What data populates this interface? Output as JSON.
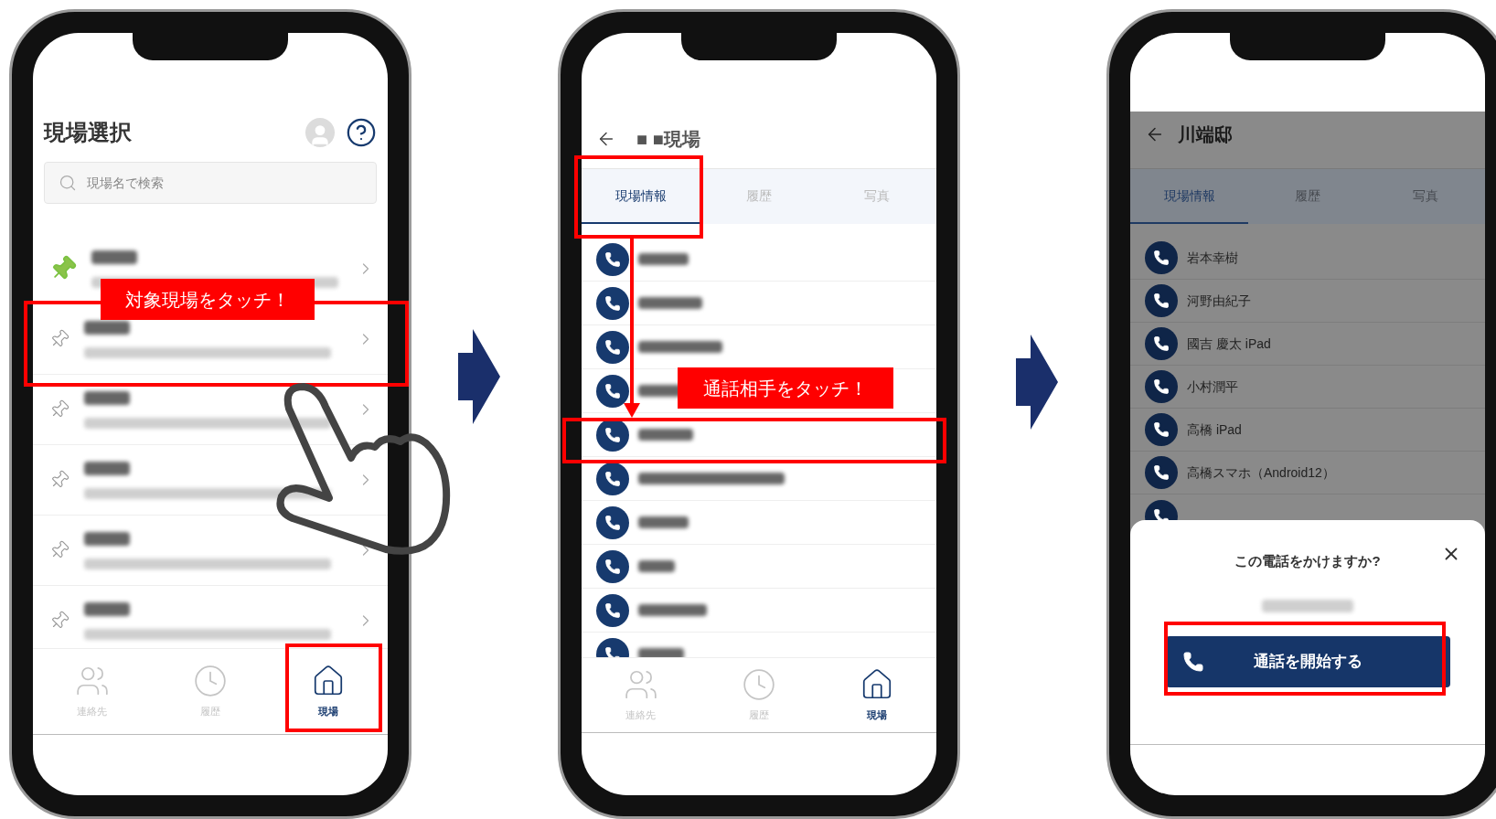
{
  "phones": [
    {
      "kind": "site_list",
      "title": "現場選択",
      "search": {
        "placeholder": "現場名で検索"
      },
      "sites": [
        {
          "pinned": true,
          "highlighted": false
        },
        {
          "pinned": false,
          "highlighted": true
        },
        {
          "pinned": false,
          "highlighted": false
        },
        {
          "pinned": false,
          "highlighted": false
        },
        {
          "pinned": false,
          "highlighted": false
        },
        {
          "pinned": false,
          "highlighted": false
        }
      ],
      "callout": "対象現場をタッチ！",
      "nav": [
        {
          "label": "連絡先",
          "selected": false,
          "highlighted": false
        },
        {
          "label": "履歴",
          "selected": false,
          "highlighted": false
        },
        {
          "label": "現場",
          "selected": true,
          "highlighted": true
        }
      ]
    },
    {
      "kind": "site_detail",
      "title": "■ ■現場",
      "tabs": [
        {
          "label": "現場情報",
          "selected": true,
          "highlighted": true
        },
        {
          "label": "履歴",
          "selected": false,
          "highlighted": false
        },
        {
          "label": "写真",
          "selected": false,
          "highlighted": false
        }
      ],
      "contacts": [
        {
          "highlighted": false
        },
        {
          "highlighted": false
        },
        {
          "highlighted": false
        },
        {
          "highlighted": false
        },
        {
          "highlighted": true
        },
        {
          "highlighted": false
        },
        {
          "highlighted": false
        },
        {
          "highlighted": false
        },
        {
          "highlighted": false
        },
        {
          "highlighted": false
        }
      ],
      "callout": "通話相手をタッチ！",
      "nav": [
        {
          "label": "連絡先",
          "selected": false
        },
        {
          "label": "履歴",
          "selected": false
        },
        {
          "label": "現場",
          "selected": true
        }
      ]
    },
    {
      "kind": "call_dialog",
      "dimmed": true,
      "title": "川端邸",
      "tabs": [
        {
          "label": "現場情報",
          "selected": true
        },
        {
          "label": "履歴",
          "selected": false
        },
        {
          "label": "写真",
          "selected": false
        }
      ],
      "contacts": [
        {
          "name": "岩本幸樹"
        },
        {
          "name": "河野由紀子"
        },
        {
          "name": "國吉 慶太 iPad"
        },
        {
          "name": "小村潤平"
        },
        {
          "name": "高橋 iPad"
        },
        {
          "name": "高橋スマホ（Android12）"
        }
      ],
      "dialog": {
        "question": "この電話をかけますか?",
        "button": "通話を開始する",
        "highlighted": true
      }
    }
  ]
}
